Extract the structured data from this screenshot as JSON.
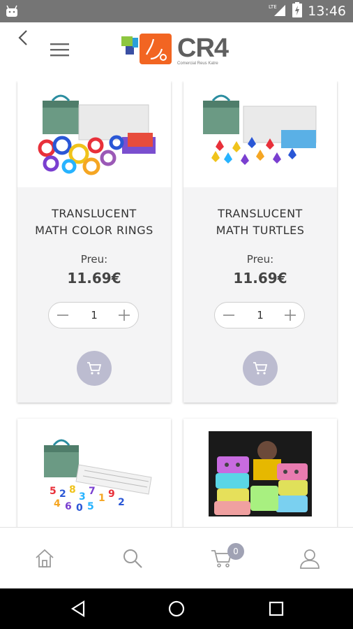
{
  "status_bar": {
    "network": "LTE",
    "time": "13:46"
  },
  "header": {
    "logo_title": "CR4",
    "logo_subtitle": "Comercial Reus Katre"
  },
  "products": [
    {
      "name_line1": "TRANSLUCENT",
      "name_line2": "MATH COLOR RINGS",
      "price_label": "Preu:",
      "price": "11.69€",
      "quantity": "1"
    },
    {
      "name_line1": "TRANSLUCENT",
      "name_line2": "MATH TURTLES",
      "price_label": "Preu:",
      "price": "11.69€",
      "quantity": "1"
    }
  ],
  "bottom_nav": {
    "cart_count": "0"
  },
  "colors": {
    "accent": "#bcbcd0",
    "badge": "#a0a2b4",
    "status_bar": "#757575",
    "card_bg": "#f4f4f5"
  }
}
